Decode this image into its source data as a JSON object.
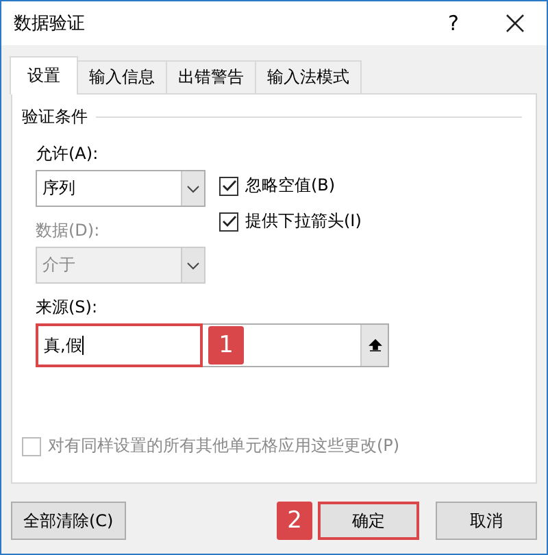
{
  "window": {
    "title": "数据验证",
    "help": "?"
  },
  "tabs": [
    {
      "label": "设置",
      "selected": true
    },
    {
      "label": "输入信息",
      "selected": false
    },
    {
      "label": "出错警告",
      "selected": false
    },
    {
      "label": "输入法模式",
      "selected": false
    }
  ],
  "section_title": "验证条件",
  "allow": {
    "label": "允许(A):",
    "value": "序列",
    "disabled": false
  },
  "data": {
    "label": "数据(D):",
    "value": "介于",
    "disabled": true
  },
  "checkboxes": [
    {
      "label": "忽略空值(B)",
      "checked": true
    },
    {
      "label": "提供下拉箭头(I)",
      "checked": true
    }
  ],
  "source": {
    "label": "来源(S):",
    "value": "真,假",
    "highlighted": true,
    "callout": "1"
  },
  "apply_all": {
    "label": "对有同样设置的所有其他单元格应用这些更改(P)",
    "checked": false,
    "disabled": true
  },
  "buttons": [
    {
      "label": "全部清除(C)",
      "kind": "left",
      "highlighted": false
    },
    {
      "label": "确定",
      "kind": "right",
      "highlighted": true,
      "callout": "2"
    },
    {
      "label": "取消",
      "kind": "right",
      "highlighted": false
    }
  ]
}
